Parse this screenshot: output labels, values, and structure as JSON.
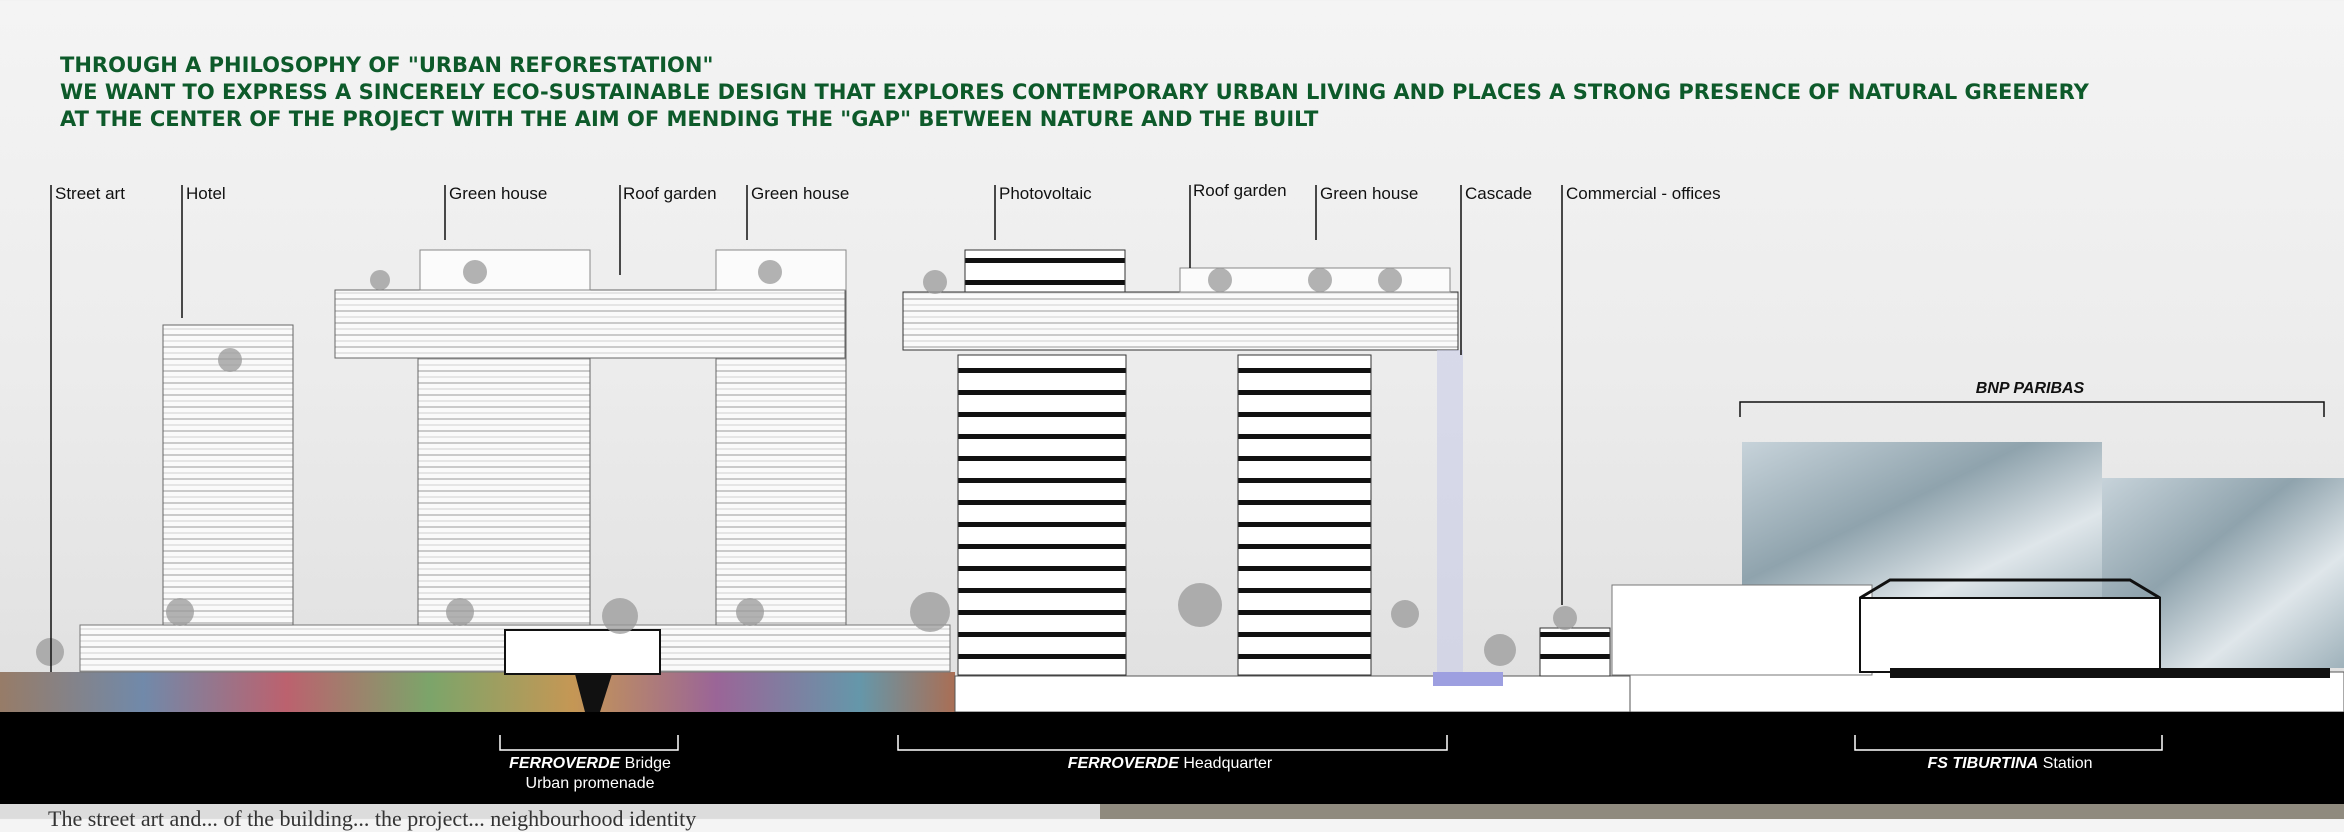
{
  "intro": {
    "line1": "THROUGH A PHILOSOPHY OF \"URBAN REFORESTATION\"",
    "line2": "WE WANT TO EXPRESS A SINCERELY ECO-SUSTAINABLE DESIGN THAT EXPLORES CONTEMPORARY URBAN LIVING AND PLACES A STRONG PRESENCE OF NATURAL GREENERY",
    "line3": "AT THE CENTER OF THE PROJECT WITH THE AIM OF MENDING THE \"GAP\" BETWEEN NATURE AND THE BUILT",
    "color": "#0d5a2a"
  },
  "labels": {
    "street_art": "Street art",
    "hotel": "Hotel",
    "green_house_1": "Green house",
    "roof_garden_1": "Roof garden",
    "green_house_2": "Green house",
    "photovoltaic": "Photovoltaic",
    "roof_garden_2": "Roof garden",
    "green_house_3": "Green house",
    "cascade": "Cascade",
    "commercial_offices": "Commercial - offices",
    "bnp_paribas": "BNP PARIBAS"
  },
  "captions": {
    "bridge_brand": "FERROVERDE",
    "bridge_word": "Bridge",
    "bridge_sub": "Urban promenade",
    "hq_brand": "FERROVERDE",
    "hq_word": "Headquarter",
    "station_brand": "FS TIBURTINA",
    "station_word": "Station"
  },
  "footer": {
    "caption_text": "The street art and... of the building... the project... neighbourhood identity"
  }
}
